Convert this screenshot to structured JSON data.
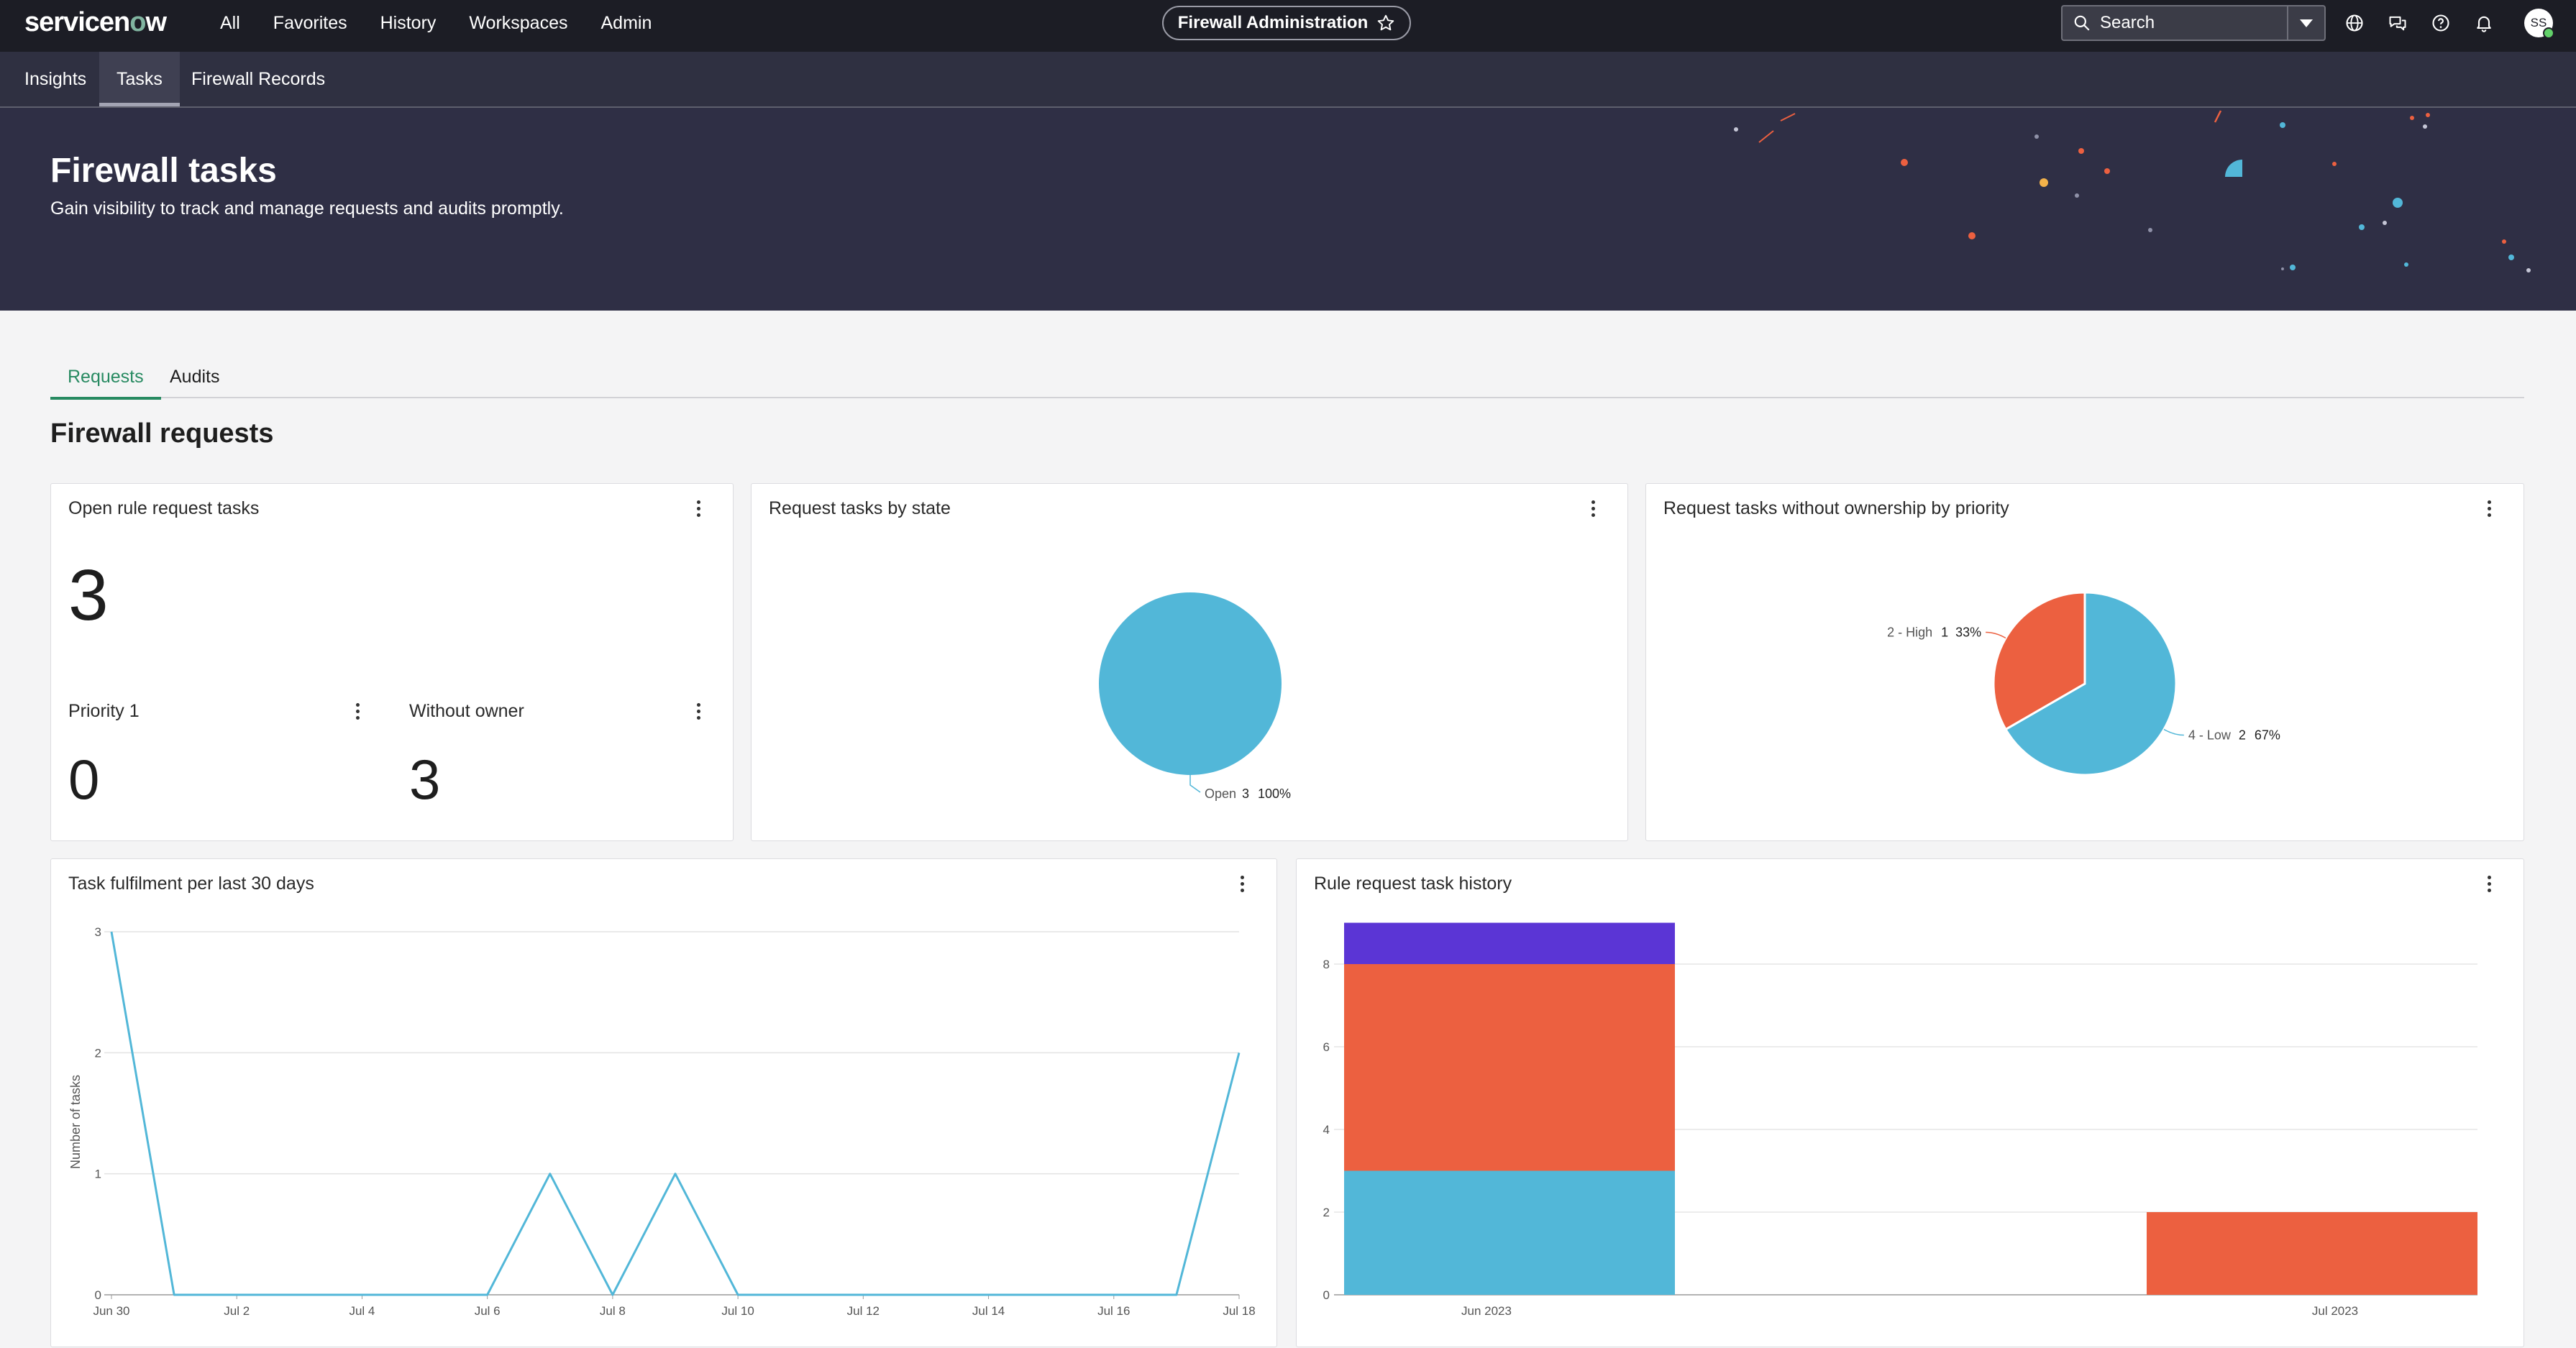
{
  "nav": {
    "logo_prefix": "servicen",
    "logo_o": "o",
    "logo_suffix": "w",
    "links": [
      "All",
      "Favorites",
      "History",
      "Workspaces",
      "Admin"
    ],
    "workspace": "Firewall Administration",
    "search_placeholder": "Search",
    "avatar_initials": "SS"
  },
  "subnav": {
    "tabs": [
      "Insights",
      "Tasks",
      "Firewall Records"
    ],
    "active": "Tasks"
  },
  "hero": {
    "title": "Firewall tasks",
    "subtitle": "Gain visibility to track and manage requests and audits promptly."
  },
  "tabs": {
    "items": [
      "Requests",
      "Audits"
    ],
    "active": "Requests"
  },
  "section_title": "Firewall requests",
  "cards": {
    "open_tasks": {
      "title": "Open rule request tasks",
      "value": "3"
    },
    "priority1": {
      "title": "Priority 1",
      "value": "0"
    },
    "without_owner": {
      "title": "Without owner",
      "value": "3"
    },
    "by_state": {
      "title": "Request tasks by state"
    },
    "by_priority": {
      "title": "Request tasks without ownership by priority"
    },
    "fulfilment": {
      "title": "Task fulfilment per last 30 days"
    },
    "history": {
      "title": "Rule request task history"
    }
  },
  "colors": {
    "blue": "#52b7d8",
    "orange": "#ec6040",
    "purple": "#5b35d5",
    "accent_green": "#278a61"
  },
  "chart_data": [
    {
      "type": "pie",
      "title": "Request tasks by state",
      "slices": [
        {
          "label": "Open",
          "value": 3,
          "percent": "100%",
          "color": "#52b7d8"
        }
      ]
    },
    {
      "type": "pie",
      "title": "Request tasks without ownership by priority",
      "slices": [
        {
          "label": "4 - Low",
          "value": 2,
          "percent": "67%",
          "color": "#52b7d8"
        },
        {
          "label": "2 - High",
          "value": 1,
          "percent": "33%",
          "color": "#ec6040"
        }
      ]
    },
    {
      "type": "line",
      "title": "Task fulfilment per last 30 days",
      "ylabel": "Number of tasks",
      "ylim": [
        0,
        3
      ],
      "yticks": [
        0,
        1,
        2,
        3
      ],
      "x_tick_labels": [
        "Jun 30",
        "Jul 2",
        "Jul 4",
        "Jul 6",
        "Jul 8",
        "Jul 10",
        "Jul 12",
        "Jul 14",
        "Jul 16",
        "Jul 18"
      ],
      "x": [
        "Jun 30",
        "Jul 1",
        "Jul 2",
        "Jul 3",
        "Jul 4",
        "Jul 5",
        "Jul 6",
        "Jul 7",
        "Jul 8",
        "Jul 9",
        "Jul 10",
        "Jul 11",
        "Jul 12",
        "Jul 13",
        "Jul 14",
        "Jul 15",
        "Jul 16",
        "Jul 17",
        "Jul 18"
      ],
      "values": [
        3,
        0,
        0,
        0,
        0,
        0,
        0,
        1,
        0,
        1,
        0,
        0,
        0,
        0,
        0,
        0,
        0,
        0,
        2
      ],
      "color": "#52b7d8"
    },
    {
      "type": "bar",
      "stacked": true,
      "title": "Rule request task history",
      "categories": [
        "Jun 2023",
        "Jul 2023"
      ],
      "ylim": [
        0,
        9
      ],
      "yticks": [
        0,
        2,
        4,
        6,
        8
      ],
      "series": [
        {
          "values": [
            3,
            0
          ],
          "color": "#52b7d8"
        },
        {
          "values": [
            5,
            2
          ],
          "color": "#ec6040"
        },
        {
          "values": [
            1,
            0
          ],
          "color": "#5b35d5"
        }
      ]
    }
  ]
}
